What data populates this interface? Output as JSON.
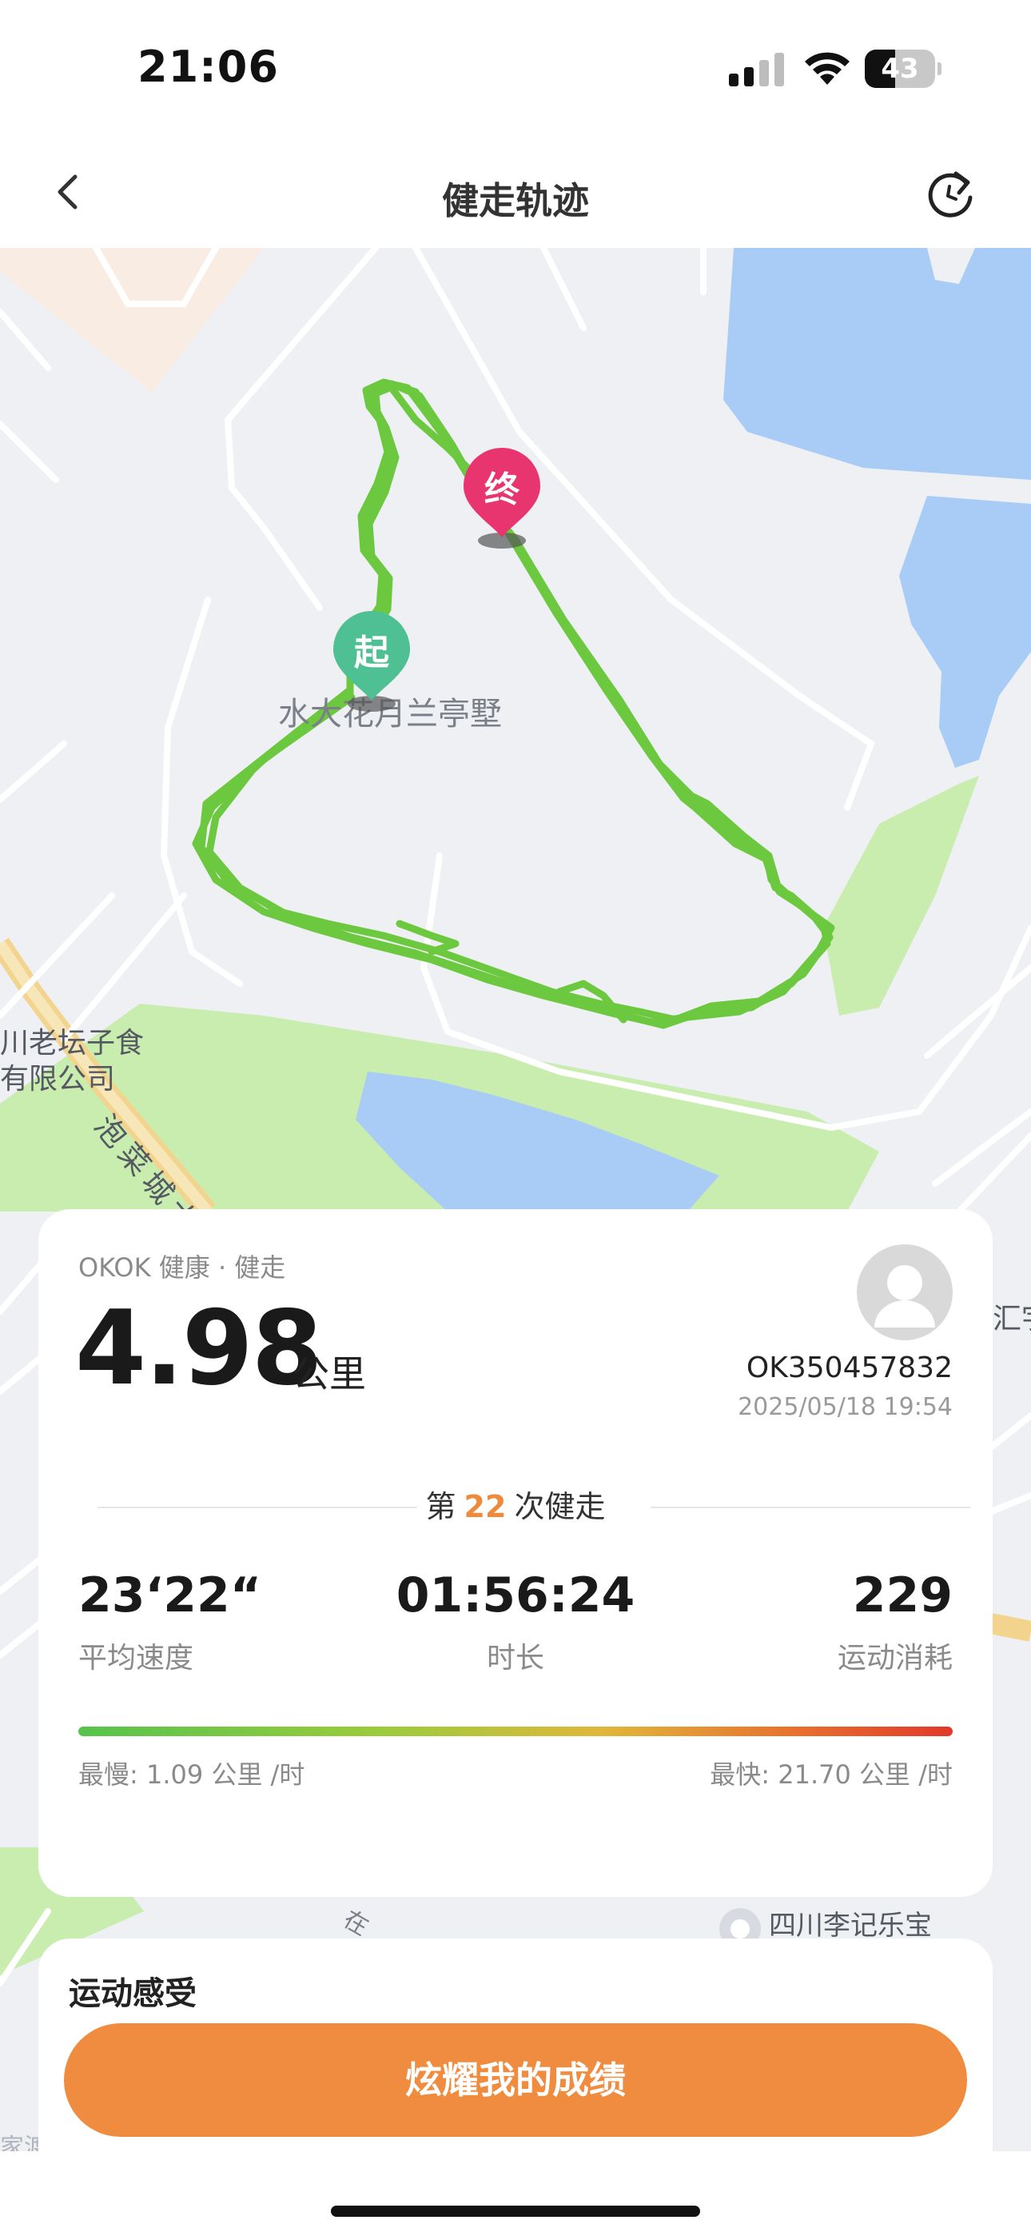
{
  "status_bar": {
    "time": "21:06",
    "battery_level": "43",
    "battery_fraction": 0.43,
    "icons": [
      "signal-icon",
      "wifi-icon",
      "battery-icon"
    ]
  },
  "nav": {
    "title": "健走轨迹",
    "back_icon": "chevron-left-icon",
    "refresh_icon": "refresh-icon"
  },
  "map": {
    "start_pin_label": "起",
    "end_pin_label": "终",
    "poi_residence": "水大花月兰亭墅",
    "poi_company_line1": "川老坛子食",
    "poi_company_line2": "有限公司",
    "road_name": "泡菜城大道",
    "poi_right_edge": "汇宇",
    "poi_bottom_right": "四川李记乐宝",
    "poi_bottom_left": "家渡",
    "poi_small": "在",
    "route_color": "#6cc93f",
    "start_pin_color": "#4fbf94",
    "end_pin_color": "#e8346f",
    "water_color": "#a8ccf6",
    "park_color": "#c9ecaf"
  },
  "stats": {
    "brand": "OKOK 健康 · 健走",
    "distance": "4.98",
    "distance_unit": "公里",
    "user_id": "OK350457832",
    "date": "2025/05/18 19:54",
    "count_prefix": "第",
    "count_number": "22",
    "count_suffix": "次健走",
    "avg_speed_value": "23‘22“",
    "avg_speed_label": "平均速度",
    "duration_value": "01:56:24",
    "duration_label": "时长",
    "calories_value": "229",
    "calories_label": "运动消耗",
    "slowest": "最慢: 1.09 公里 /时",
    "fastest": "最快: 21.70 公里 /时"
  },
  "feeling": {
    "title": "运动感受"
  },
  "share_button": "炫耀我的成绩"
}
